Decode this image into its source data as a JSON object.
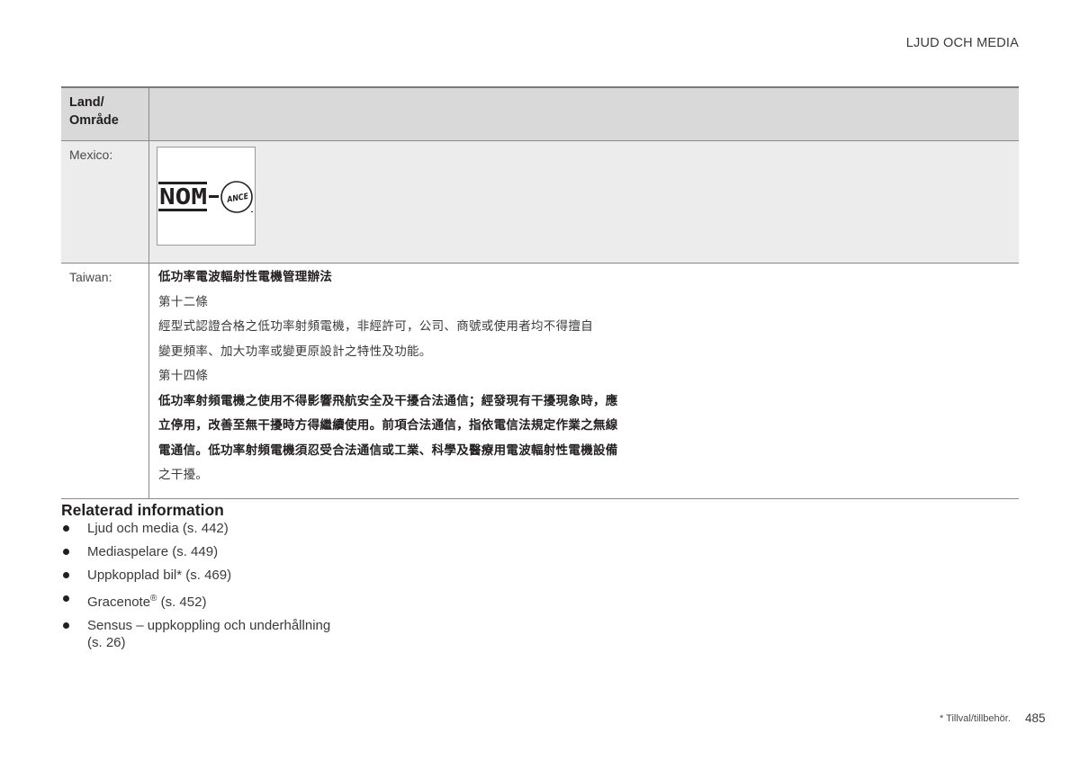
{
  "header": {
    "section_title": "LJUD OCH MEDIA"
  },
  "table": {
    "header_label": "Land/\nOmråde",
    "rows": [
      {
        "land": "Mexico:",
        "logo": {
          "text_main": "NOM",
          "text_sub": "ANCE",
          "icon": "nom-ance-logo"
        }
      },
      {
        "land": "Taiwan:",
        "lines": [
          {
            "text": "低功率電波輻射性電機管理辦法",
            "bold": true
          },
          {
            "text": "第十二條",
            "bold": false
          },
          {
            "text": "經型式認證合格之低功率射頻電機，非經許可，公司、商號或使用者均不得擅自",
            "bold": false
          },
          {
            "text": "變更頻率、加大功率或變更原設計之特性及功能。",
            "bold": false
          },
          {
            "text": "第十四條",
            "bold": false
          },
          {
            "text": "低功率射頻電機之使用不得影響飛航安全及干擾合法通信；經發現有干擾現象時，應",
            "bold": true
          },
          {
            "text": "立停用，改善至無干擾時方得繼續使用。前項合法通信，指依電信法規定作業之無線",
            "bold": true
          },
          {
            "text": "電通信。低功率射頻電機須忍受合法通信或工業、科學及醫療用電波輻射性電機設備",
            "bold": true
          },
          {
            "text": "之干擾。",
            "bold": false
          }
        ]
      }
    ]
  },
  "related": {
    "title": "Relaterad information",
    "items": [
      {
        "text": "Ljud och media (s. 442)"
      },
      {
        "text": "Mediaspelare (s. 449)"
      },
      {
        "text": "Uppkopplad bil* (s. 469)"
      },
      {
        "text_before": "Gracenote",
        "sup": "®",
        "text_after": " (s. 452)"
      },
      {
        "text": "Sensus – uppkoppling och underhållning",
        "text2": "(s. 26)"
      }
    ]
  },
  "footer": {
    "note": "* Tillval/tillbehör.",
    "page_number": "485"
  }
}
